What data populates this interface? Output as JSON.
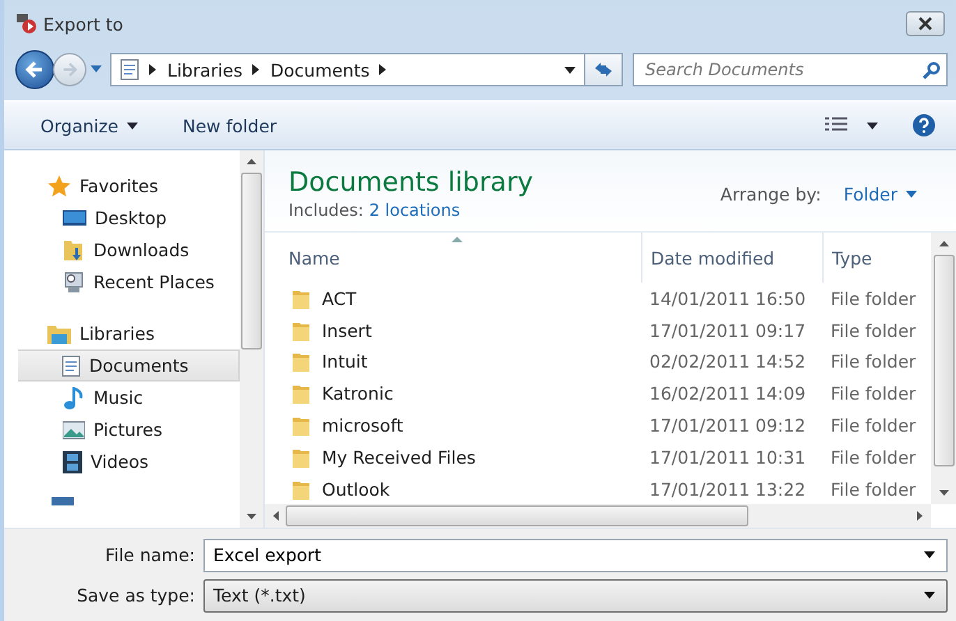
{
  "window": {
    "title": "Export to"
  },
  "address": {
    "crumbs": [
      "Libraries",
      "Documents"
    ]
  },
  "search": {
    "placeholder": "Search Documents"
  },
  "toolbar": {
    "organize": "Organize",
    "new_folder": "New folder"
  },
  "sidebar": {
    "sections": [
      {
        "label": "Favorites",
        "items": [
          {
            "label": "Desktop",
            "selected": false
          },
          {
            "label": "Downloads",
            "selected": false
          },
          {
            "label": "Recent Places",
            "selected": false
          }
        ]
      },
      {
        "label": "Libraries",
        "items": [
          {
            "label": "Documents",
            "selected": true
          },
          {
            "label": "Music",
            "selected": false
          },
          {
            "label": "Pictures",
            "selected": false
          },
          {
            "label": "Videos",
            "selected": false
          }
        ]
      }
    ]
  },
  "library": {
    "title": "Documents library",
    "includes_label": "Includes:",
    "includes_link": "2 locations",
    "arrange_label": "Arrange by:",
    "arrange_value": "Folder"
  },
  "table": {
    "columns": [
      "Name",
      "Date modified",
      "Type"
    ],
    "rows": [
      {
        "name": "ACT",
        "date": "14/01/2011 16:50",
        "type": "File folder"
      },
      {
        "name": "Insert",
        "date": "17/01/2011 09:17",
        "type": "File folder"
      },
      {
        "name": "Intuit",
        "date": "02/02/2011 14:52",
        "type": "File folder"
      },
      {
        "name": "Katronic",
        "date": "16/02/2011 14:09",
        "type": "File folder"
      },
      {
        "name": "microsoft",
        "date": "17/01/2011 09:12",
        "type": "File folder"
      },
      {
        "name": "My Received Files",
        "date": "17/01/2011 10:31",
        "type": "File folder"
      },
      {
        "name": "Outlook",
        "date": "17/01/2011 13:22",
        "type": "File folder"
      }
    ]
  },
  "form": {
    "file_name_label": "File name:",
    "file_name": "Excel export",
    "type_label": "Save as type:",
    "type_value": "Text (*.txt)"
  }
}
